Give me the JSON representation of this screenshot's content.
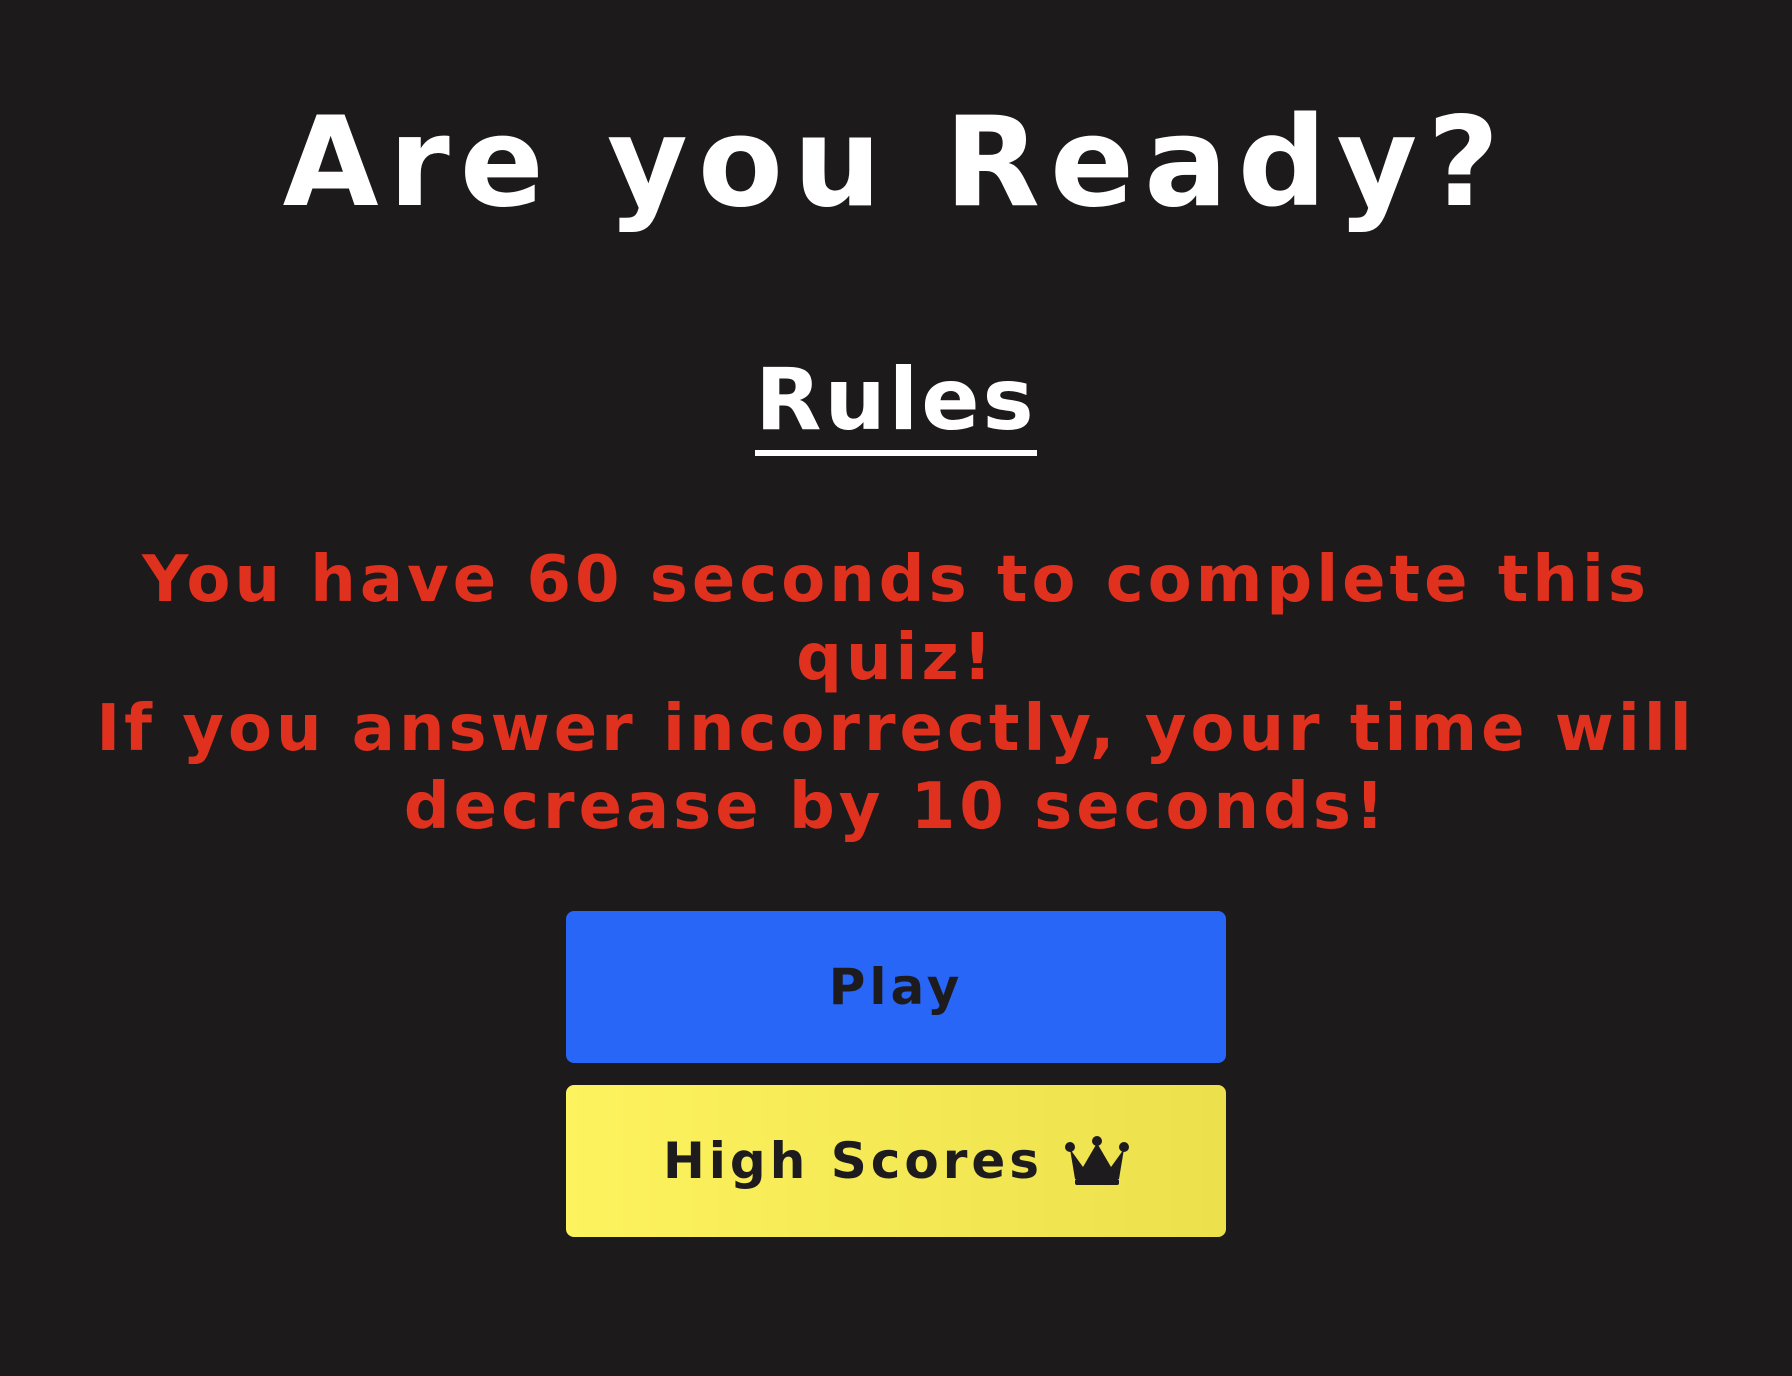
{
  "header": {
    "title": "Are you Ready?"
  },
  "rules": {
    "heading": "Rules",
    "items": [
      "You have 60 seconds to complete this quiz!",
      "If you answer incorrectly, your time will decrease by 10 seconds!"
    ]
  },
  "actions": {
    "play_label": "Play",
    "high_scores_label": "High Scores",
    "high_scores_icon": "crown-icon"
  },
  "colors": {
    "background": "#1c1a1b",
    "title": "#ffffff",
    "rule_text": "#e0301e",
    "play_button": "#2866f7",
    "high_scores_button": "#fdf35e",
    "button_text": "#1d1b1d"
  }
}
